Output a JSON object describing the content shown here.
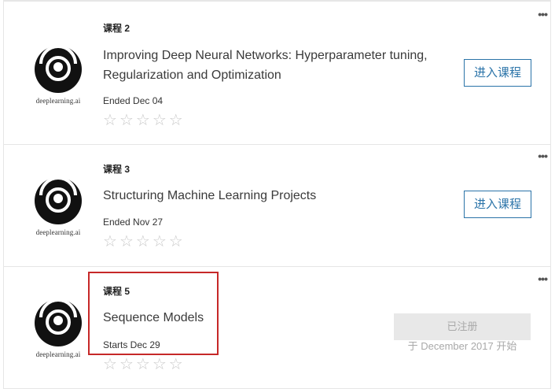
{
  "courses": [
    {
      "number_label": "课程 2",
      "title": "Improving Deep Neural Networks: Hyperparameter tuning, Regularization and Optimization",
      "status": "Ended Dec 04",
      "action_label": "进入课程",
      "logo_text": "deeplearning.ai",
      "rating_stars": 0,
      "more_icon": "more-horizontal-icon"
    },
    {
      "number_label": "课程 3",
      "title": "Structuring Machine Learning Projects",
      "status": "Ended Nov 27",
      "action_label": "进入课程",
      "logo_text": "deeplearning.ai",
      "rating_stars": 0,
      "more_icon": "more-horizontal-icon"
    },
    {
      "number_label": "课程 5",
      "title": "Sequence Models",
      "status": "Starts Dec 29",
      "action_label": "已注册",
      "start_note": "于 December 2017 开始",
      "logo_text": "deeplearning.ai",
      "rating_stars": 0,
      "more_icon": "more-horizontal-icon"
    }
  ],
  "ui": {
    "star_glyph": "☆",
    "more_glyph": "•••"
  },
  "colors": {
    "accent": "#2a73a8",
    "highlight": "#c62828",
    "disabled_bg": "#e8e8e8",
    "disabled_text": "#a9a9a9"
  }
}
